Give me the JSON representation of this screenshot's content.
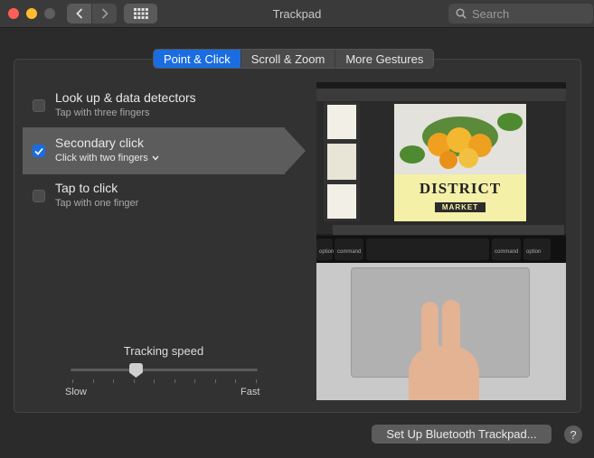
{
  "window": {
    "title": "Trackpad"
  },
  "search": {
    "placeholder": "Search"
  },
  "tabs": [
    {
      "label": "Point & Click",
      "active": true
    },
    {
      "label": "Scroll & Zoom",
      "active": false
    },
    {
      "label": "More Gestures",
      "active": false
    }
  ],
  "options": [
    {
      "title": "Look up & data detectors",
      "subtitle": "Tap with three fingers",
      "checked": false,
      "selected": false
    },
    {
      "title": "Secondary click",
      "subtitle": "Click with two fingers",
      "checked": true,
      "selected": true
    },
    {
      "title": "Tap to click",
      "subtitle": "Tap with one finger",
      "checked": false,
      "selected": false
    }
  ],
  "tracking": {
    "label": "Tracking speed",
    "min_label": "Slow",
    "max_label": "Fast",
    "level_fraction": 0.35
  },
  "preview": {
    "poster_title": "DISTRICT",
    "poster_subtitle": "MARKET",
    "keys": [
      "option",
      "command",
      "command",
      "option"
    ]
  },
  "footer": {
    "bluetooth_button": "Set Up Bluetooth Trackpad...",
    "help_label": "?"
  },
  "colors": {
    "accent": "#1a6de0",
    "window_bg": "#2b2b2b",
    "selection": "#5c5c5c"
  },
  "icons": [
    "close-icon",
    "minimize-icon",
    "zoom-icon",
    "back-icon",
    "forward-icon",
    "grid-icon",
    "search-icon",
    "checkmark-icon",
    "chevron-down-icon"
  ]
}
